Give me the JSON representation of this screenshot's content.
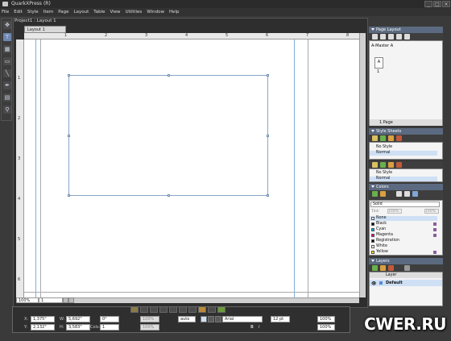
{
  "window": {
    "title": "QuarkXPress (R)",
    "minimize": "_",
    "maximize": "□",
    "close": "×"
  },
  "menu": [
    "File",
    "Edit",
    "Style",
    "Item",
    "Page",
    "Layout",
    "Table",
    "View",
    "Utilities",
    "Window",
    "Help"
  ],
  "document": {
    "title": "Project1 : Layout 1",
    "tab": "Layout 1",
    "zoom": "100%",
    "page": "1"
  },
  "ruler": {
    "top": [
      "1",
      "2",
      "3",
      "4",
      "5",
      "6",
      "7",
      "8"
    ],
    "left": [
      "1",
      "2",
      "3",
      "4",
      "5",
      "6"
    ]
  },
  "measurements": {
    "x_label": "X:",
    "x": "1,375\"",
    "y_label": "Y:",
    "y": "2,132\"",
    "w_label": "W:",
    "w": "5,692\"",
    "h_label": "H:",
    "h": "3,583\"",
    "angle": "0°",
    "cols_label": "Cols:",
    "cols": "1",
    "percent1": "100%",
    "percent2": "100%",
    "leading": "auto",
    "font": "Arial",
    "size": "12 pt",
    "scale1": "100%",
    "scale2": "100%",
    "bold": "B",
    "italic": "I"
  },
  "page_layout": {
    "title": "Page Layout",
    "master": "A-Master A",
    "page_label": "A",
    "page_number": "1",
    "footer": "1 Page"
  },
  "style_sheets": {
    "title": "Style Sheets",
    "paragraph": [
      "No Style",
      "Normal"
    ],
    "character": [
      "No Style",
      "Normal"
    ]
  },
  "colors": {
    "title": "Colors",
    "mode": "Solid",
    "tint_label": "Tint:",
    "tint": "100%",
    "opacity": "100%",
    "items": [
      {
        "name": "None",
        "color": "#ffffff"
      },
      {
        "name": "Black",
        "color": "#000000"
      },
      {
        "name": "Cyan",
        "color": "#00a0e0"
      },
      {
        "name": "Magenta",
        "color": "#e0008a"
      },
      {
        "name": "Registration",
        "color": "#000000"
      },
      {
        "name": "White",
        "color": "#ffffff"
      },
      {
        "name": "Yellow",
        "color": "#ffe600"
      }
    ]
  },
  "layers": {
    "title": "Layers",
    "column": "Layer",
    "items": [
      {
        "name": "Default"
      }
    ]
  },
  "watermark": "CWER.RU"
}
